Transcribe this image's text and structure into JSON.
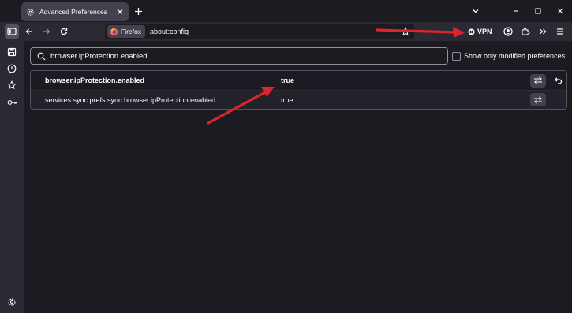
{
  "tab": {
    "title": "Advanced Preferences"
  },
  "toolbar": {
    "identity_label": "Firefox",
    "url": "about:config",
    "vpn_label": "VPN"
  },
  "search": {
    "value": "browser.ipProtection.enabled"
  },
  "modified_toggle": {
    "label": "Show only modified preferences"
  },
  "prefs": [
    {
      "name": "browser.ipProtection.enabled",
      "value": "true",
      "modified": true
    },
    {
      "name": "services.sync.prefs.sync.browser.ipProtection.enabled",
      "value": "true",
      "modified": false
    }
  ],
  "colors": {
    "background": "#1c1b22",
    "toolbar": "#2b2a33",
    "annotation_arrow": "#e0242b",
    "firefox_logo": "#ff7139"
  },
  "icons": {
    "tab": "gear-icon",
    "toolbar": [
      "sidebar-toggle-icon",
      "back-icon",
      "forward-icon",
      "reload-icon",
      "star-icon",
      "account-icon",
      "extensions-icon",
      "overflow-chevron-icon",
      "menu-icon"
    ],
    "sidebar": [
      "save-icon",
      "history-icon",
      "bookmarks-icon",
      "passwords-icon",
      "settings-icon"
    ]
  }
}
